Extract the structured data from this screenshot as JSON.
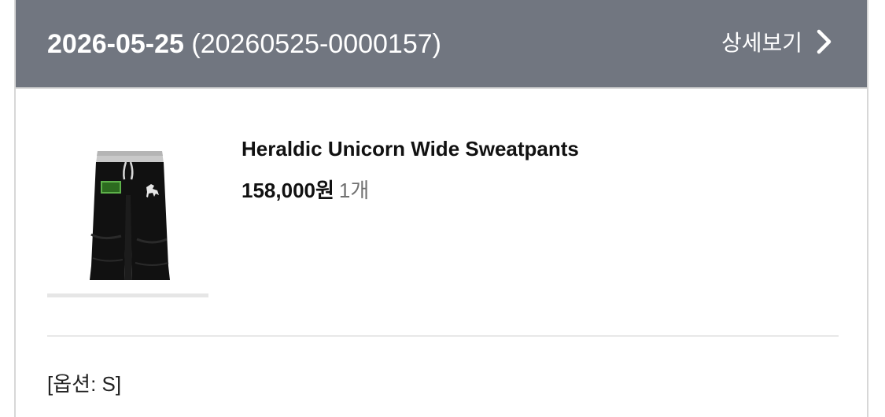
{
  "order": {
    "date": "2026-05-25",
    "number": "(20260525-0000157)",
    "detail_label": "상세보기"
  },
  "product": {
    "name": "Heraldic Unicorn Wide Sweatpants",
    "price": "158,000원",
    "quantity": "1개",
    "option": "[옵션: S]",
    "image_icon": "sweatpants-product-image"
  },
  "colors": {
    "header_bg": "#717680",
    "header_text": "#ffffff"
  }
}
